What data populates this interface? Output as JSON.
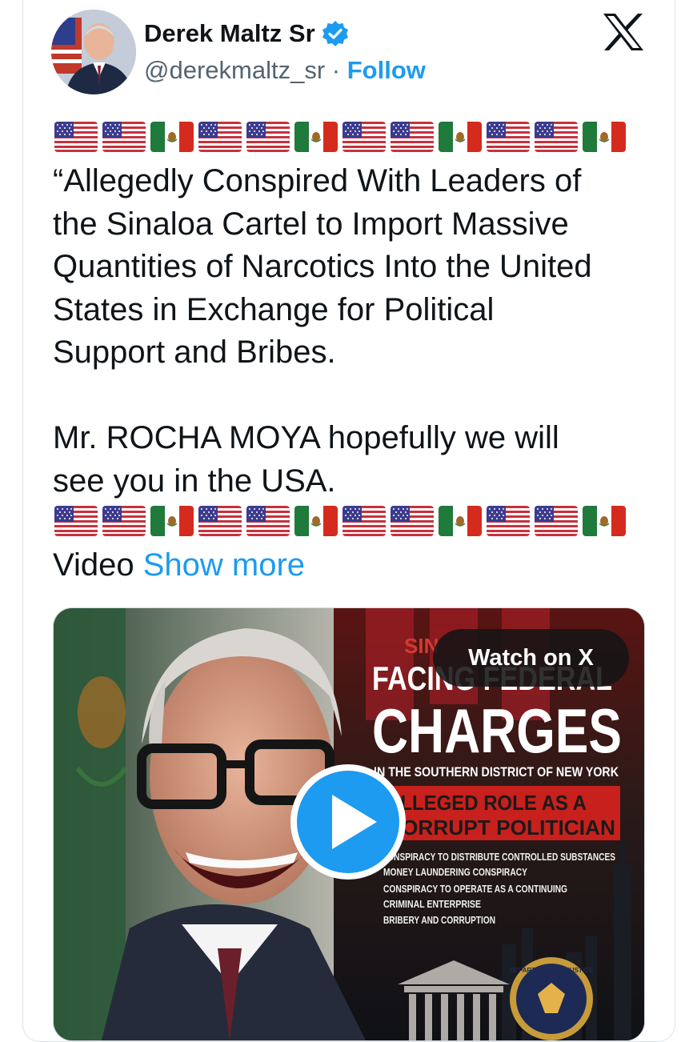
{
  "author": {
    "name": "Derek Maltz Sr",
    "handle": "@derekmaltz_sr",
    "separator": "·",
    "follow_label": "Follow"
  },
  "icons": {
    "verified": "verified-badge-icon",
    "platform": "x-logo-icon",
    "play": "play-icon"
  },
  "flag_sequence": [
    "us",
    "us",
    "mx",
    "us",
    "us",
    "mx",
    "us",
    "us",
    "mx",
    "us",
    "us",
    "mx"
  ],
  "tweet": {
    "text": "“Allegedly Conspired With Leaders of\nthe Sinaloa Cartel to Import Massive\nQuantities of Narcotics Into the United\nStates in Exchange for Political\nSupport and Bribes.\n\nMr. ROCHA MOYA hopefully  we will\nsee you in the USA.",
    "video_label": "Video",
    "show_more": "Show more"
  },
  "media": {
    "watch_label": "Watch on X",
    "poster": {
      "tag": "SIN",
      "line1": "FACING FEDERAL",
      "line2": "CHARGES",
      "district": "IN THE SOUTHERN DISTRICT OF NEW YORK",
      "role1": "ALLEGED ROLE AS A",
      "role2": "CORRUPT POLITICIAN",
      "charges": [
        "CONSPIRACY TO DISTRIBUTE CONTROLLED SUBSTANCES",
        "MONEY LAUNDERING CONSPIRACY",
        "CONSPIRACY TO OPERATE AS A CONTINUING",
        "CRIMINAL ENTERPRISE",
        "BRIBERY AND CORRUPTION"
      ],
      "seal_text": "DEPARTMENT OF JUSTICE"
    }
  },
  "colors": {
    "link": "#1d9bf0",
    "text": "#0f1419",
    "secondary": "#536471",
    "poster_red": "#c8201c"
  }
}
